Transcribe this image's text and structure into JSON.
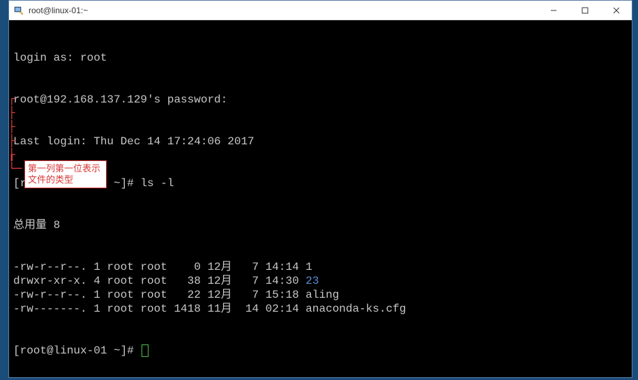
{
  "window": {
    "title": "root@linux-01:~"
  },
  "terminal": {
    "login_prompt": "login as: root",
    "password_prompt": "root@192.168.137.129's password:",
    "last_login": "Last login: Thu Dec 14 17:24:06 2017",
    "prompt1_user": "[root@linux-01 ~]# ",
    "prompt1_cmd": "ls -l",
    "total_line": "总用量 8",
    "ls_entries": [
      {
        "perm": "-rw-r--r--.",
        "links": "1",
        "owner": "root",
        "group": "root",
        "size": "   0",
        "month": "12月",
        "day": " 7",
        "time": "14:14",
        "name": "1",
        "color": "dim"
      },
      {
        "perm": "drwxr-xr-x.",
        "links": "4",
        "owner": "root",
        "group": "root",
        "size": "  38",
        "month": "12月",
        "day": " 7",
        "time": "14:30",
        "name": "23",
        "color": "blue"
      },
      {
        "perm": "-rw-r--r--.",
        "links": "1",
        "owner": "root",
        "group": "root",
        "size": "  22",
        "month": "12月",
        "day": " 7",
        "time": "15:18",
        "name": "aling",
        "color": "dim"
      },
      {
        "perm": "-rw-------.",
        "links": "1",
        "owner": "root",
        "group": "root",
        "size": "1418",
        "month": "11月",
        "day": "14",
        "time": "02:14",
        "name": "anaconda-ks.cfg",
        "color": "dim"
      }
    ],
    "prompt2_user": "[root@linux-01 ~]# "
  },
  "annotation": {
    "text": "第一列第一位表示\n文件的类型"
  }
}
